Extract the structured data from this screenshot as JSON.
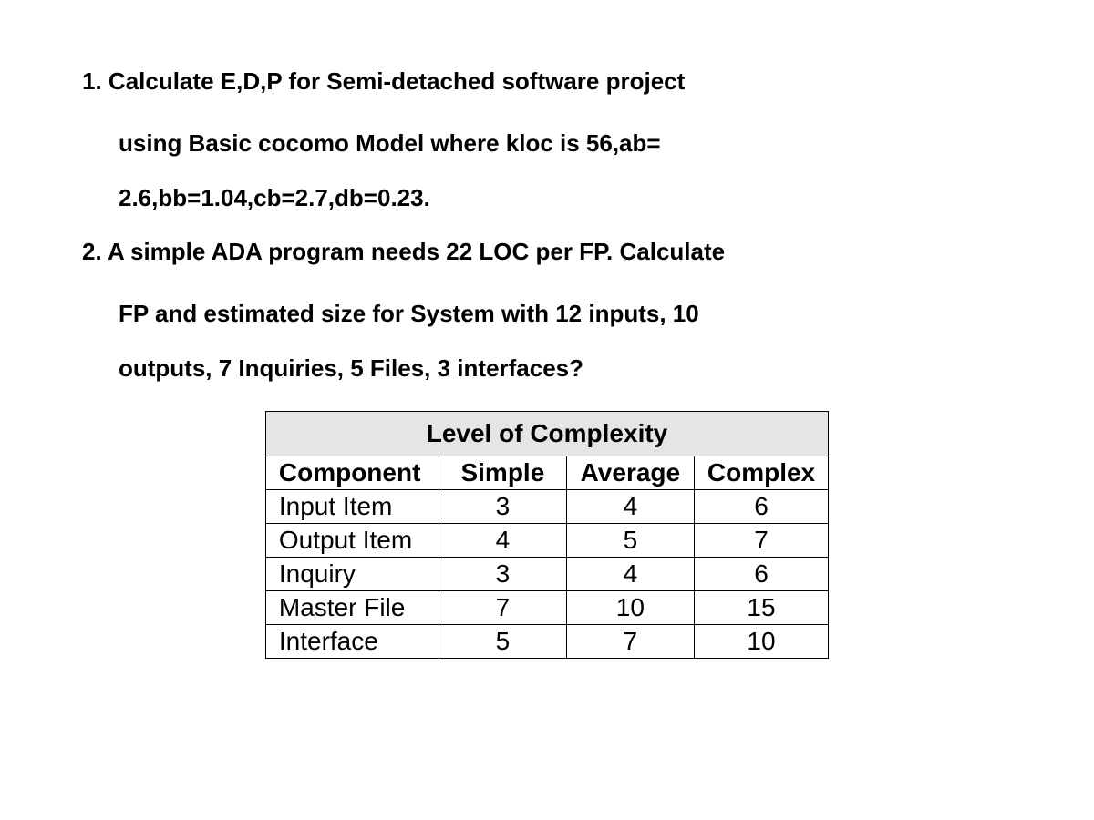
{
  "questions": {
    "q1": {
      "marker": "1.",
      "line1": "Calculate E,D,P for Semi-detached software project",
      "line2": "using Basic cocomo Model where kloc is 56,ab=",
      "line3": "2.6,bb=1.04,cb=2.7,db=0.23."
    },
    "q2": {
      "marker": "2.",
      "line1": "A simple ADA program needs 22 LOC per FP. Calculate",
      "line2": "FP and estimated size for System with 12 inputs, 10",
      "line3": "outputs, 7 Inquiries, 5 Files, 3 interfaces?"
    }
  },
  "chart_data": {
    "type": "table",
    "title": "Level of Complexity",
    "headers": [
      "Component",
      "Simple",
      "Average",
      "Complex"
    ],
    "rows": [
      {
        "component": "Input Item",
        "simple": "3",
        "average": "4",
        "complex": "6"
      },
      {
        "component": "Output Item",
        "simple": "4",
        "average": "5",
        "complex": "7"
      },
      {
        "component": "Inquiry",
        "simple": "3",
        "average": "4",
        "complex": "6"
      },
      {
        "component": "Master File",
        "simple": "7",
        "average": "10",
        "complex": "15"
      },
      {
        "component": "Interface",
        "simple": "5",
        "average": "7",
        "complex": "10"
      }
    ]
  }
}
